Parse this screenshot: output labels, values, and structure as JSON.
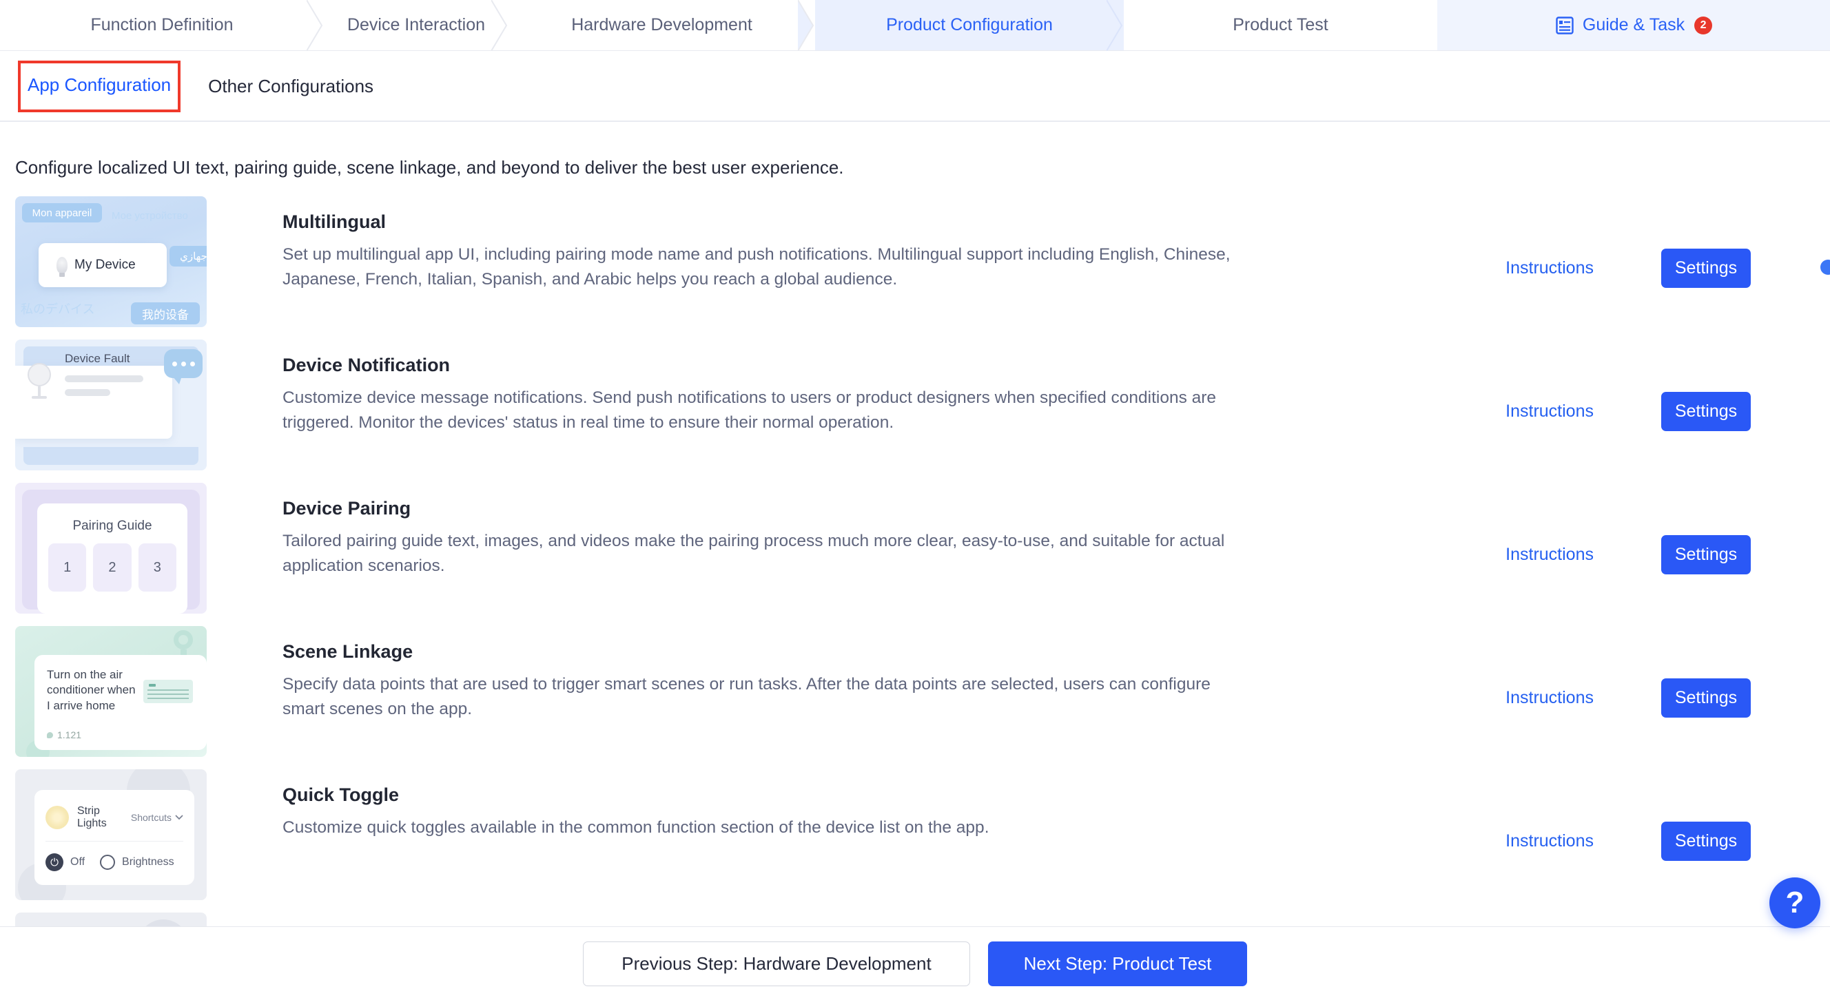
{
  "stepnav": {
    "steps": [
      {
        "label": "Function Definition",
        "active": false
      },
      {
        "label": "Device Interaction",
        "active": false
      },
      {
        "label": "Hardware Development",
        "active": false
      },
      {
        "label": "Product Configuration",
        "active": true
      },
      {
        "label": "Product Test",
        "active": false
      }
    ],
    "guide": {
      "label": "Guide & Task",
      "badge": "2",
      "icon": "document-list-icon"
    }
  },
  "subtabs": [
    {
      "label": "App Configuration",
      "active": true
    },
    {
      "label": "Other Configurations",
      "active": false
    }
  ],
  "page": {
    "description": "Configure localized UI text, pairing guide, scene linkage, and beyond to deliver the best user experience."
  },
  "cards": [
    {
      "title": "Multilingual",
      "desc": "Set up multilingual app UI, including pairing mode name and push notifications. Multilingual support including English, Chinese, Japanese, French, Italian, Spanish, and Arabic helps you reach a global audience.",
      "instructions": "Instructions",
      "settings": "Settings",
      "thumb": {
        "type": "multilingual",
        "device_label": "My Device",
        "languages": [
          "Mon appareil",
          "Мое устройство",
          "جهازي",
          "私のデバイス",
          "我的设备"
        ]
      }
    },
    {
      "title": "Device Notification",
      "desc": "Customize device message notifications. Send push notifications to users or product designers when specified conditions are triggered. Monitor the devices' status in real time to ensure their normal operation.",
      "instructions": "Instructions",
      "settings": "Settings",
      "thumb": {
        "type": "notification",
        "title": "Device Fault"
      }
    },
    {
      "title": "Device Pairing",
      "desc": "Tailored pairing guide text, images, and videos make the pairing process much more clear, easy-to-use, and suitable for actual application scenarios.",
      "instructions": "Instructions",
      "settings": "Settings",
      "thumb": {
        "type": "pairing",
        "title": "Pairing Guide",
        "steps": [
          "1",
          "2",
          "3"
        ]
      }
    },
    {
      "title": "Scene Linkage",
      "desc": "Specify data points that are used to trigger smart scenes or run tasks. After the data points are selected, users can configure smart scenes on the app.",
      "instructions": "Instructions",
      "settings": "Settings",
      "thumb": {
        "type": "scene",
        "text": "Turn on the air conditioner when I arrive home",
        "count": "1.121"
      }
    },
    {
      "title": "Quick Toggle",
      "desc": "Customize quick toggles available in the common function section of the device list on the app.",
      "instructions": "Instructions",
      "settings": "Settings",
      "thumb": {
        "type": "toggle",
        "device": "Strip Lights",
        "menu": "Shortcuts",
        "power": "Off",
        "brightness": "Brightness"
      }
    }
  ],
  "bottom": {
    "prev_label": "Previous Step: Hardware Development",
    "next_label": "Next Step: Product Test"
  },
  "help": {
    "label": "?"
  },
  "colors": {
    "accent": "#2a58f6",
    "link": "#2560f0",
    "active_tab_bg": "#eaf0fe",
    "badge_red": "#e8372b",
    "highlight_outline": "#f0392b"
  }
}
